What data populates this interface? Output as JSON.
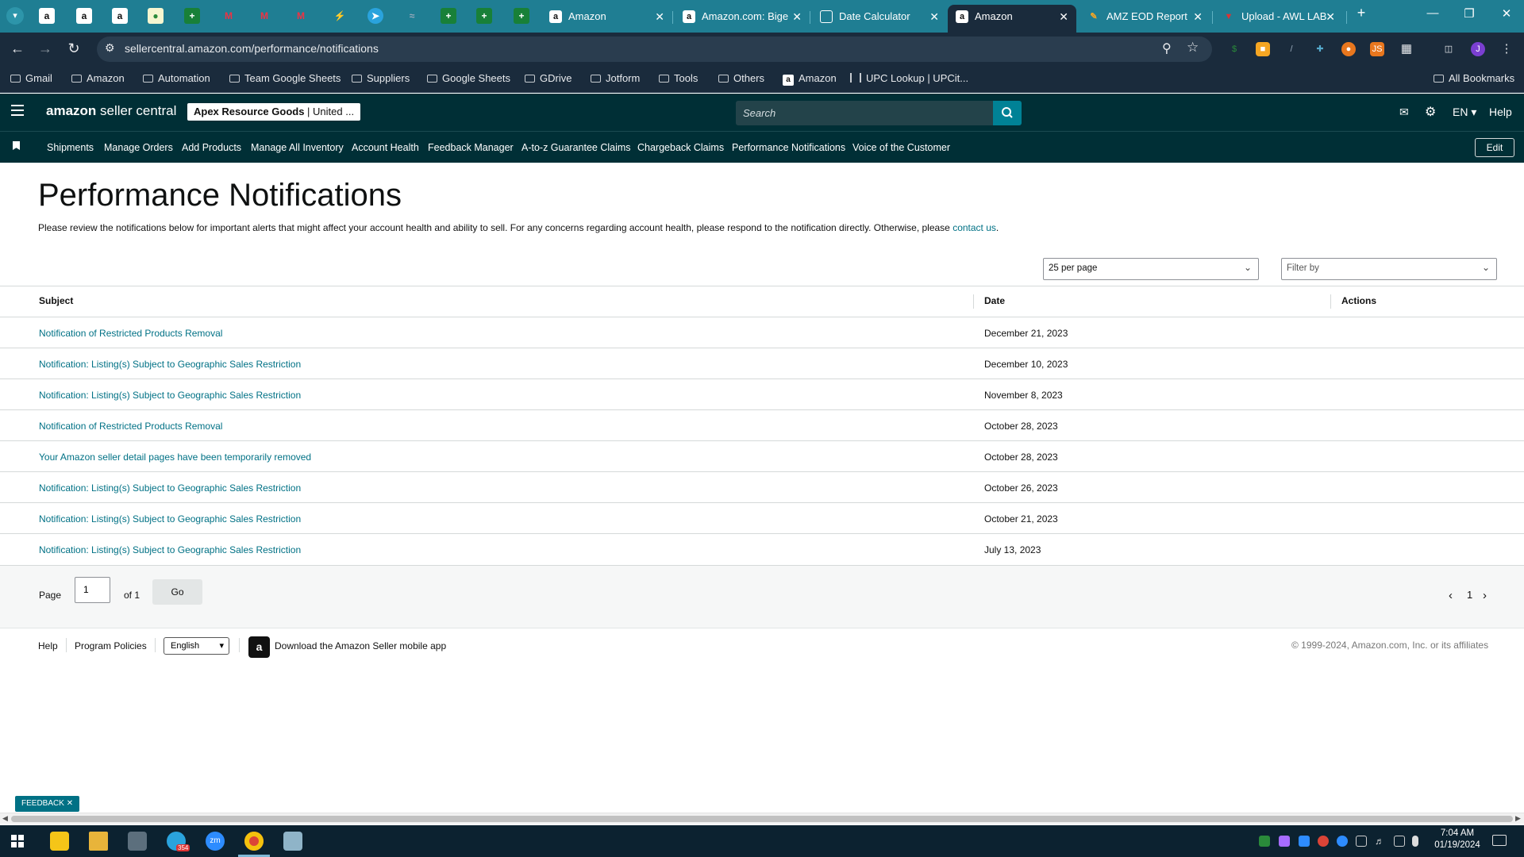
{
  "browser": {
    "tabs": [
      {
        "label": "Amazon",
        "favicon": "amazon-icon"
      },
      {
        "label": "Amazon.com: Bige",
        "favicon": "amazon-icon"
      },
      {
        "label": "Date Calculator",
        "favicon": "calculator-icon"
      },
      {
        "label": "Amazon",
        "favicon": "amazon-icon",
        "active": true
      },
      {
        "label": "AMZ EOD Report",
        "favicon": "report-icon"
      },
      {
        "label": "Upload - AWL LAB",
        "favicon": "upload-icon"
      }
    ],
    "url": "sellercentral.amazon.com/performance/notifications",
    "bookmarks": [
      "Gmail",
      "Amazon",
      "Automation",
      "Team Google Sheets",
      "Suppliers",
      "Google Sheets",
      "GDrive",
      "Jotform",
      "Tools",
      "Others",
      "Amazon",
      "UPC Lookup | UPCit..."
    ],
    "all_bookmarks": "All Bookmarks"
  },
  "header": {
    "logo_brand": "amazon",
    "logo_product": " seller central",
    "store_name": "Apex Resource Goods",
    "store_region": " | United ...",
    "search_placeholder": "Search",
    "language": "EN",
    "help": "Help"
  },
  "nav": {
    "links": [
      "Shipments",
      "Manage Orders",
      "Add Products",
      "Manage All Inventory",
      "Account Health",
      "Feedback Manager",
      "A-to-z Guarantee Claims",
      "Chargeback Claims",
      "Performance Notifications",
      "Voice of the Customer"
    ],
    "edit": "Edit"
  },
  "main": {
    "title": "Performance Notifications",
    "intro": "Please review the notifications below for important alerts that might affect your account health and ability to sell. For any concerns regarding account health, please respond to the notification directly. Otherwise, please ",
    "intro_link": "contact us",
    "intro_end": ".",
    "per_page": "25 per page",
    "filter_placeholder": "Filter by",
    "columns": {
      "subject": "Subject",
      "date": "Date",
      "actions": "Actions"
    },
    "rows": [
      {
        "subject": "Notification of Restricted Products Removal",
        "date": "December 21, 2023"
      },
      {
        "subject": "Notification: Listing(s) Subject to Geographic Sales Restriction",
        "date": "December 10, 2023"
      },
      {
        "subject": "Notification: Listing(s) Subject to Geographic Sales Restriction",
        "date": "November 8, 2023"
      },
      {
        "subject": "Notification of Restricted Products Removal",
        "date": "October 28, 2023"
      },
      {
        "subject": "Your Amazon seller detail pages have been temporarily removed",
        "date": "October 28, 2023"
      },
      {
        "subject": "Notification: Listing(s) Subject to Geographic Sales Restriction",
        "date": "October 26, 2023"
      },
      {
        "subject": "Notification: Listing(s) Subject to Geographic Sales Restriction",
        "date": "October 21, 2023"
      },
      {
        "subject": "Notification: Listing(s) Subject to Geographic Sales Restriction",
        "date": "July 13, 2023"
      }
    ],
    "pager": {
      "page_label": "Page",
      "page_value": "1",
      "of": "of 1",
      "go": "Go",
      "current": "1"
    }
  },
  "footer": {
    "help": "Help",
    "policies": "Program Policies",
    "language": "English",
    "app": "Download the Amazon Seller mobile app",
    "copyright": "© 1999-2024, Amazon.com, Inc. or its affiliates",
    "feedback": "FEEDBACK"
  },
  "taskbar": {
    "time": "7:04 AM",
    "date": "01/19/2024",
    "badge": "354"
  },
  "colors": {
    "link": "#007185",
    "header_bg": "#002f36",
    "tabstrip": "#1f7e93",
    "accent": "#008296"
  }
}
